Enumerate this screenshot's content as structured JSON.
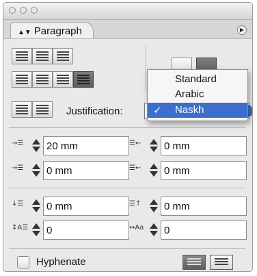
{
  "panel": {
    "tab_label": "Paragraph",
    "tab_icon": "up-down-arrows-icon",
    "menu_icon": "panel-menu-icon"
  },
  "justification": {
    "label": "Justification:",
    "options": [
      "Standard",
      "Arabic",
      "Naskh"
    ],
    "selected": "Naskh",
    "check_mark": "✓"
  },
  "indents": {
    "left_indent": "20 mm",
    "right_indent": "0 mm",
    "first_line_indent": "0 mm",
    "last_line_indent": "0 mm",
    "space_before": "0 mm",
    "space_after": "0 mm",
    "drop_cap_lines": "0",
    "drop_cap_chars": "0"
  },
  "hyphenate": {
    "label": "Hyphenate",
    "checked": false
  },
  "colors": {
    "accent": "#3c6fcb",
    "panel_bg": "#e9e9e9"
  }
}
